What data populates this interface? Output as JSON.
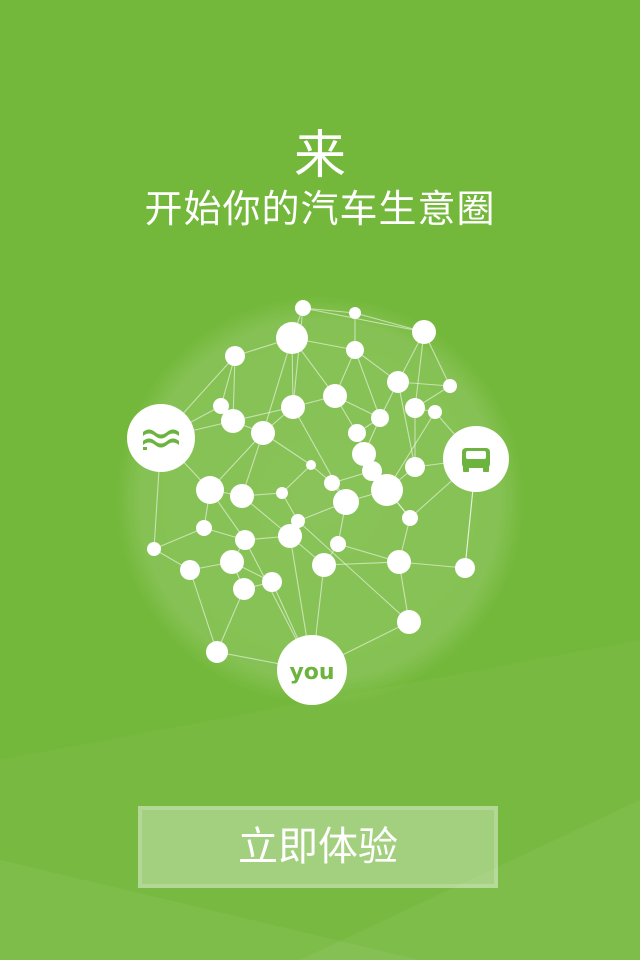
{
  "header": {
    "title": "来",
    "subtitle": "开始你的汽车生意圈"
  },
  "network": {
    "you_label": "you",
    "left_hub_icon": "flag-wave-icon",
    "right_hub_icon": "car-front-icon"
  },
  "cta": {
    "label": "立即体验"
  },
  "colors": {
    "background": "#73b83a",
    "accent_green": "#6db33f",
    "white": "#ffffff"
  }
}
